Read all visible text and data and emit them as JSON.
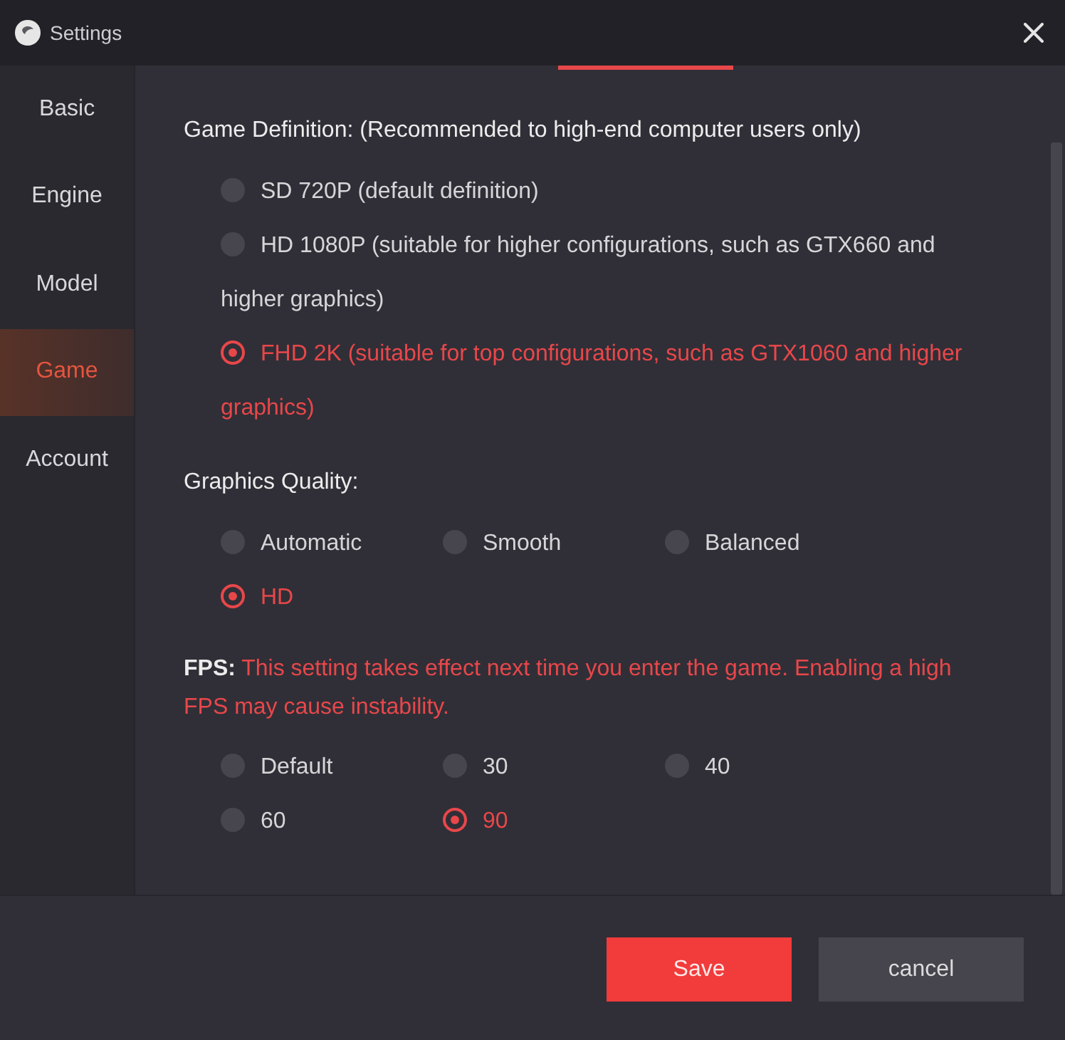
{
  "window": {
    "title": "Settings"
  },
  "sidebar": {
    "items": [
      {
        "label": "Basic",
        "selected": false
      },
      {
        "label": "Engine",
        "selected": false
      },
      {
        "label": "Model",
        "selected": false
      },
      {
        "label": "Game",
        "selected": true
      },
      {
        "label": "Account",
        "selected": false
      }
    ]
  },
  "sections": [
    {
      "title": "Game Definition: (Recommended to high-end computer users only)",
      "kind": "list",
      "options": [
        {
          "label": "SD 720P (default definition)",
          "selected": false
        },
        {
          "label": "HD 1080P (suitable for higher configurations, such as GTX660 and higher graphics)",
          "selected": false
        },
        {
          "label": "FHD 2K (suitable for top configurations, such as GTX1060 and higher graphics)",
          "selected": true
        }
      ]
    },
    {
      "title": "Graphics Quality:",
      "kind": "grid",
      "options": [
        {
          "label": "Automatic",
          "selected": false
        },
        {
          "label": "Smooth",
          "selected": false
        },
        {
          "label": "Balanced",
          "selected": false
        },
        {
          "label": "HD",
          "selected": true
        }
      ]
    },
    {
      "title": "FPS:",
      "note": "This setting takes effect next time you enter the game. Enabling a high FPS may cause instability.",
      "kind": "grid",
      "options": [
        {
          "label": "Default",
          "selected": false
        },
        {
          "label": "30",
          "selected": false
        },
        {
          "label": "40",
          "selected": false
        },
        {
          "label": "60",
          "selected": false
        },
        {
          "label": "90",
          "selected": true
        }
      ]
    }
  ],
  "buttons": [
    {
      "label": "Save",
      "kind": "primary"
    },
    {
      "label": "cancel",
      "kind": "secondary"
    }
  ]
}
